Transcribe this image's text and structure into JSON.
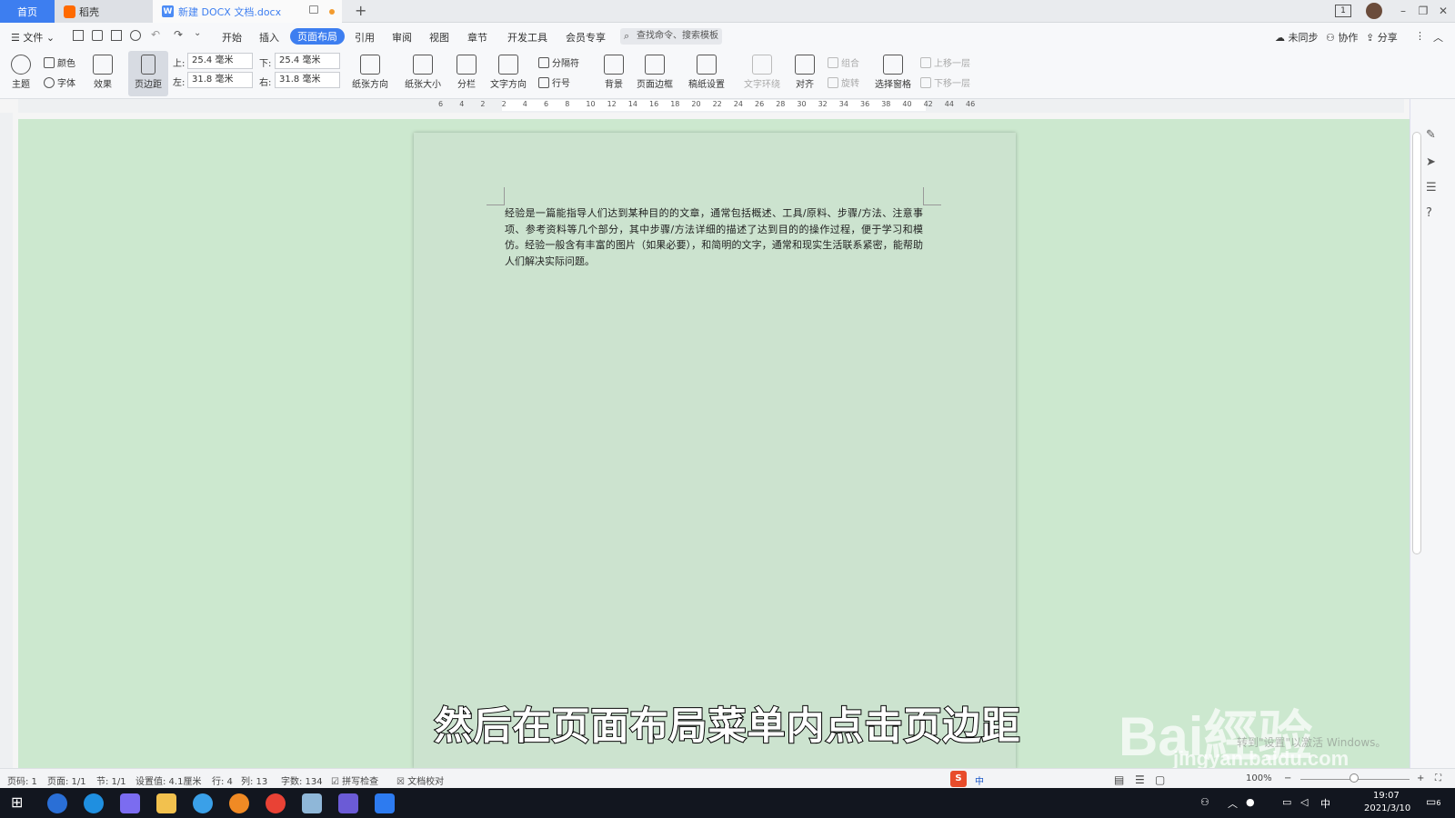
{
  "tabs": {
    "home": "首页",
    "daoke": "稻壳",
    "doc": "新建 DOCX 文档.docx"
  },
  "menu": {
    "file": "文件",
    "items": [
      "开始",
      "插入",
      "页面布局",
      "引用",
      "审阅",
      "视图",
      "章节",
      "开发工具",
      "会员专享"
    ],
    "search_placeholder": "查找命令、搜索模板",
    "right": [
      "未同步",
      "协作",
      "分享"
    ]
  },
  "ribbon": {
    "theme": "主题",
    "color": "颜色",
    "font": "字体",
    "effect": "效果",
    "margins": "页边距",
    "top_label": "上:",
    "top_value": "25.4 毫米",
    "bottom_label": "下:",
    "bottom_value": "25.4 毫米",
    "left_label": "左:",
    "left_value": "31.8 毫米",
    "right_label": "右:",
    "right_value": "31.8 毫米",
    "orientation": "纸张方向",
    "size": "纸张大小",
    "columns": "分栏",
    "text_direction": "文字方向",
    "breaks": "分隔符",
    "line_numbers": "行号",
    "background": "背景",
    "page_border": "页面边框",
    "draft_settings": "稿纸设置",
    "text_wrap": "文字环绕",
    "align": "对齐",
    "group": "组合",
    "rotate": "旋转",
    "selection_pane": "选择窗格",
    "bring_forward": "上移一层",
    "send_backward": "下移一层"
  },
  "ruler_numbers": [
    "6",
    "4",
    "2",
    "2",
    "4",
    "6",
    "8",
    "10",
    "12",
    "14",
    "16",
    "18",
    "20",
    "22",
    "24",
    "26",
    "28",
    "30",
    "32",
    "34",
    "36",
    "38",
    "40",
    "42",
    "44",
    "46"
  ],
  "document": {
    "body": "经验是一篇能指导人们达到某种目的的文章，通常包括概述、工具/原料、步骤/方法、注意事项、参考资料等几个部分，其中步骤/方法详细的描述了达到目的的操作过程，便于学习和模仿。经验一般含有丰富的图片（如果必要），和简明的文字，通常和现实生活联系紧密，能帮助人们解决实际问题。"
  },
  "subtitle": "然后在页面布局菜单内点击页边距",
  "watermark": {
    "logo": "Bai經验",
    "url": "jingyan.baidu.com",
    "faint": "转到\"设置\"以激活 Windows。"
  },
  "status": {
    "page_num": "页码: 1",
    "pages": "页面: 1/1",
    "section": "节: 1/1",
    "setting": "设置值: 4.1厘米",
    "row": "行: 4",
    "col": "列: 13",
    "words": "字数: 134",
    "spellcheck": "拼写检查",
    "proofread": "文档校对",
    "zoom": "100%"
  },
  "taskbar": {
    "time": "19:07",
    "date": "2021/3/10",
    "ime": "中",
    "notif_count": "6"
  }
}
